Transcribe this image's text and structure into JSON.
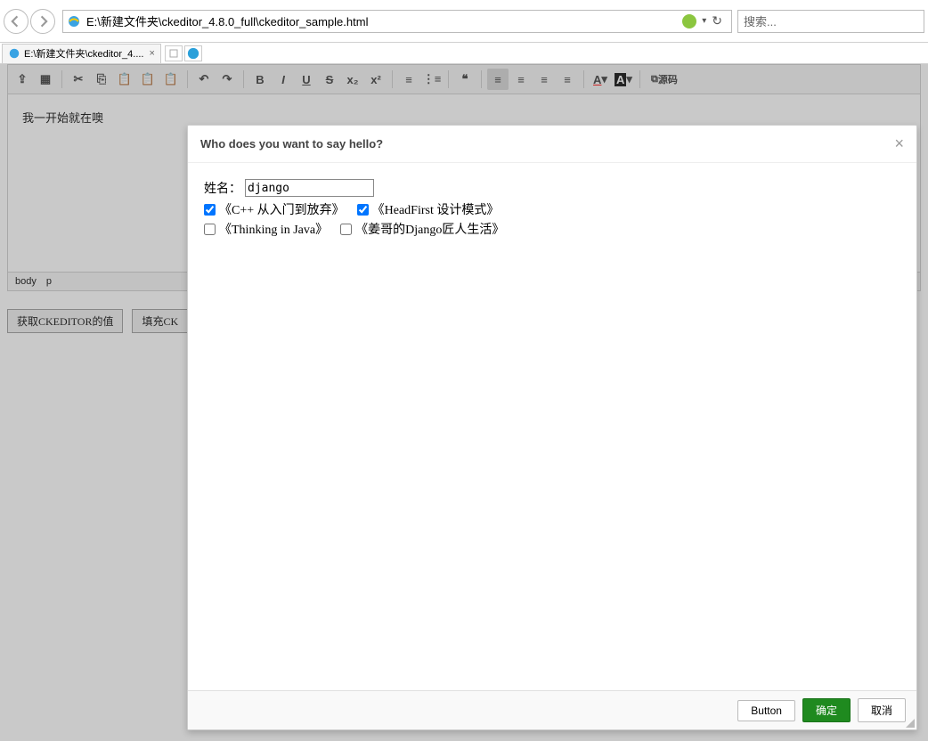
{
  "browser": {
    "url": "E:\\新建文件夹\\ckeditor_4.8.0_full\\ckeditor_sample.html",
    "search_placeholder": "搜索...",
    "tab_title": "E:\\新建文件夹\\ckeditor_4...."
  },
  "editor": {
    "content": "我一开始就在噢",
    "status_body": "body",
    "status_p": "p",
    "source_label": "源码"
  },
  "buttons": {
    "get": "获取CKEDITOR的值",
    "fill": "填充CK"
  },
  "dialog": {
    "title": "Who does you want to say hello?",
    "name_label": "姓名：",
    "name_value": "django",
    "options": [
      {
        "label": "《C++ 从入门到放弃》",
        "checked": true
      },
      {
        "label": "《HeadFirst 设计模式》",
        "checked": true
      },
      {
        "label": "《Thinking in Java》",
        "checked": false
      },
      {
        "label": "《姜哥的Django匠人生活》",
        "checked": false
      }
    ],
    "btn_button": "Button",
    "btn_ok": "确定",
    "btn_cancel": "取消"
  }
}
